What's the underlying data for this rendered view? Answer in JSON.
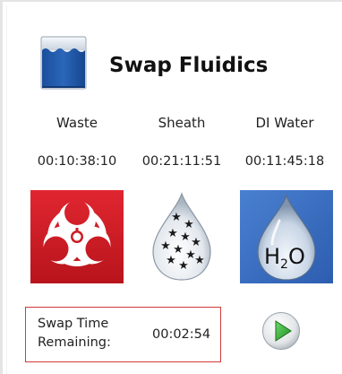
{
  "header": {
    "title": "Swap Fluidics",
    "icon": "fluidics-container-icon"
  },
  "columns": [
    {
      "label": "Waste",
      "time": "00:10:38:10",
      "icon": "biohazard-icon",
      "color": "#d0202a"
    },
    {
      "label": "Sheath",
      "time": "00:21:11:51",
      "icon": "sheath-droplet-icon",
      "color": "#ffffff"
    },
    {
      "label": "DI Water",
      "time": "00:11:45:18",
      "icon": "h2o-droplet-icon",
      "color": "#3a6fc4",
      "glyph": "H",
      "glyph_sub": "2",
      "glyph_tail": "O"
    }
  ],
  "swap": {
    "label": "Swap Time Remaining:",
    "time": "00:02:54",
    "border_color": "#d23a3a"
  },
  "actions": {
    "play_icon": "play-icon",
    "play_color": "#2aa02a"
  }
}
